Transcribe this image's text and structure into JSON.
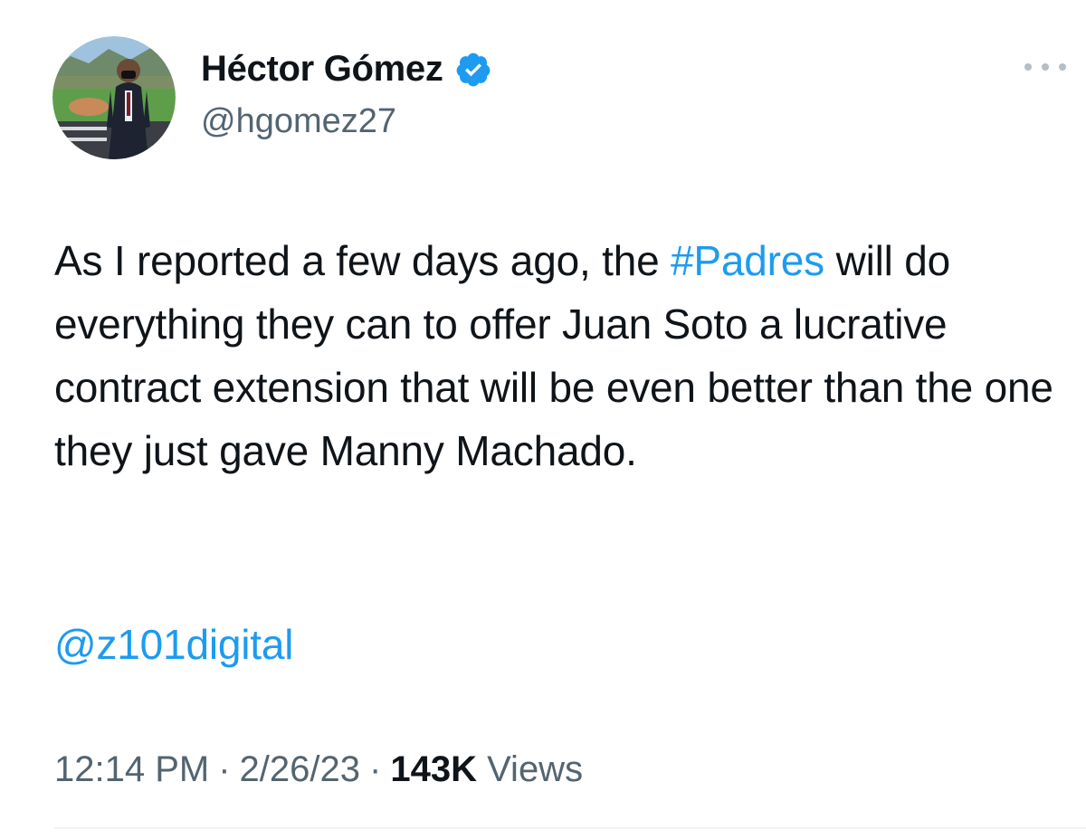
{
  "author": {
    "display_name": "Héctor Gómez",
    "handle": "@hgomez27",
    "verified": true,
    "verified_icon": "verified-badge-icon",
    "verified_color": "#1d9bf0",
    "avatar_description": "avatar"
  },
  "more_menu_icon": "more-horizontal-icon",
  "tweet": {
    "text_before_hashtag": "As I reported a few days ago, the ",
    "hashtag": "#Padres",
    "text_after_hashtag": " will do everything they can to offer Juan Soto a lucrative contract extension that will be even better than the one they just gave Manny Machado.",
    "mention": "@z101digital"
  },
  "meta": {
    "time": "12:14 PM",
    "separator": "·",
    "date": "2/26/23",
    "views_count": "143K",
    "views_label": "Views"
  },
  "colors": {
    "link": "#1d9bf0",
    "text": "#0f1419",
    "secondary": "#536471",
    "divider": "#eff3f4"
  }
}
